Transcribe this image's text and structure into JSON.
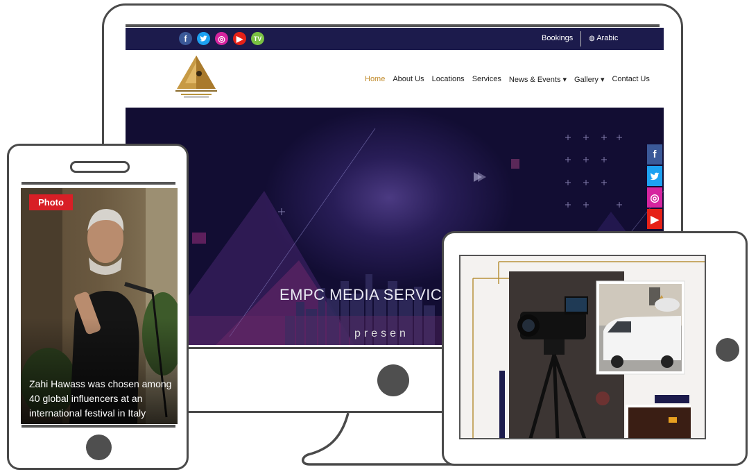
{
  "desktop": {
    "topbar": {
      "social_icons": [
        "facebook-icon",
        "twitter-icon",
        "instagram-icon",
        "youtube-icon",
        "tv-icon"
      ],
      "social_glyphs": {
        "facebook": "f",
        "twitter": "t",
        "instagram": "◎",
        "youtube": "▶",
        "tv": "TV"
      },
      "bookings_label": "Bookings",
      "language_label": "Arabic",
      "background_color": "#1c1b4c"
    },
    "nav": {
      "items": [
        "Home",
        "About Us",
        "Locations",
        "Services",
        "News & Events ▾",
        "Gallery ▾",
        "Contact Us"
      ],
      "active_color": "#c18b2b"
    },
    "hero": {
      "title": "EMPC MEDIA SERVICES",
      "subtitle": "presen"
    },
    "side_social": {
      "glyphs": [
        "f",
        "t",
        "◎",
        "▶"
      ],
      "colors": [
        "#3b5998",
        "#1da1f2",
        "#d6249f",
        "#e62117"
      ]
    }
  },
  "phone": {
    "badge": "Photo",
    "headline": "Zahi Hawass was chosen among 40 global influencers at an international festival in Italy",
    "badge_color": "#d81f26"
  },
  "tablet": {
    "images": [
      "camera-on-tripod",
      "broadcast-van",
      "night-street"
    ]
  }
}
